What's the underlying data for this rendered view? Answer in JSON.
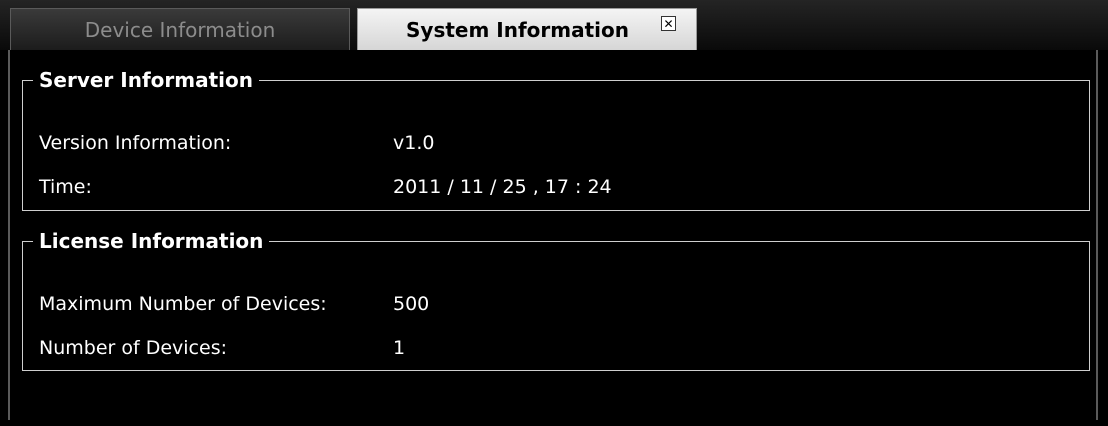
{
  "tabs": {
    "device_info": "Device Information",
    "system_info": "System Information",
    "close_symbol": "✕"
  },
  "server": {
    "title": "Server Information",
    "version_label": "Version Information:",
    "version_value": "v1.0",
    "time_label": "Time:",
    "time_value": "2011 / 11 / 25 , 17 : 24"
  },
  "license": {
    "title": "License Information",
    "max_devices_label": "Maximum Number of Devices:",
    "max_devices_value": "500",
    "devices_label": "Number of Devices:",
    "devices_value": "1"
  },
  "colors": {
    "background": "#000000",
    "text": "#ffffff",
    "border": "#cfcfcf",
    "inactive_tab_text": "#8c8c8c",
    "active_tab_bg": "#e8e8e8"
  },
  "icons": {
    "tab_close": "close-icon"
  }
}
